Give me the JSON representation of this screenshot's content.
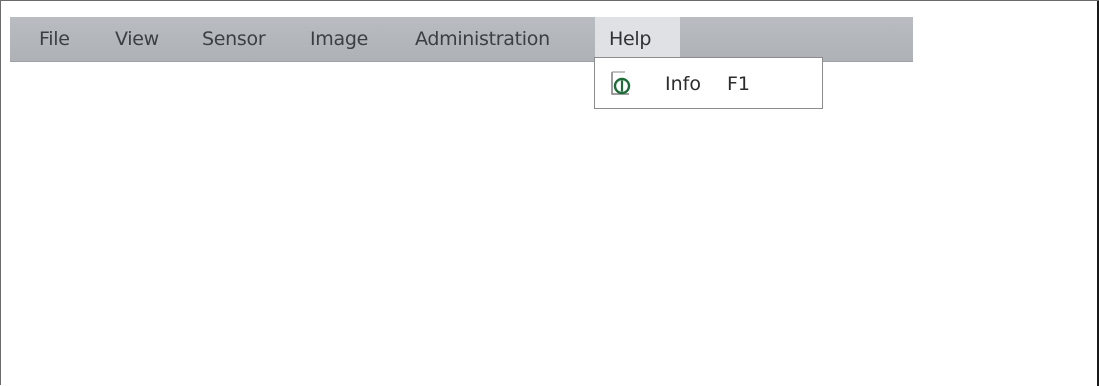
{
  "menubar": {
    "items": [
      {
        "label": "File"
      },
      {
        "label": "View"
      },
      {
        "label": "Sensor"
      },
      {
        "label": "Image"
      },
      {
        "label": "Administration"
      },
      {
        "label": "Help",
        "active": true
      }
    ]
  },
  "help_menu": {
    "items": [
      {
        "icon": "info-icon",
        "label": "Info",
        "shortcut": "F1"
      }
    ]
  },
  "colors": {
    "menubar_bg": "#b2b6bb",
    "active_menu_bg": "#dfe1e4",
    "menu_text": "#3b3f44",
    "icon_green": "#1e6b3a"
  }
}
